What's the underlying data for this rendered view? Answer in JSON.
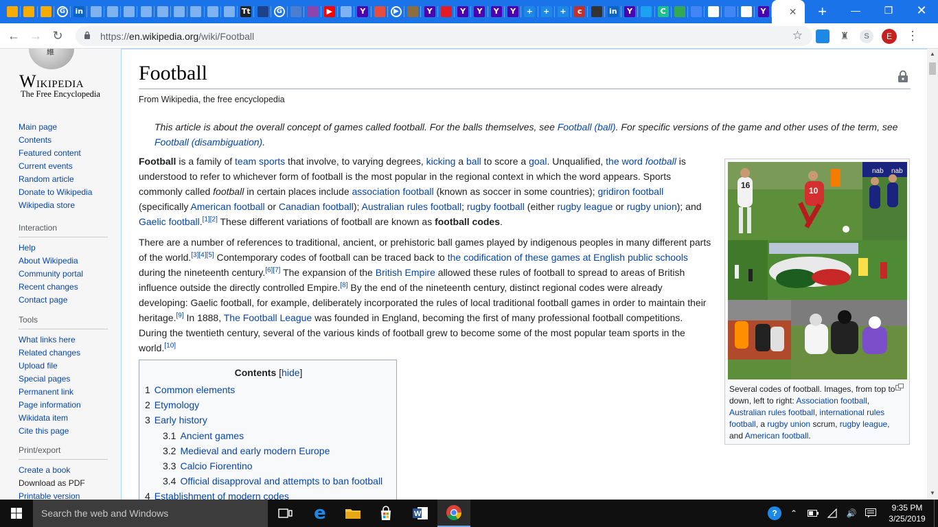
{
  "browser": {
    "tabs": [
      {
        "icon": "analytics-icon",
        "glyph": "",
        "color": "#f9ab00"
      },
      {
        "icon": "analytics-icon",
        "glyph": "",
        "color": "#f9ab00"
      },
      {
        "icon": "analytics-icon",
        "glyph": "",
        "color": "#f9ab00"
      },
      {
        "icon": "google-icon",
        "glyph": "G",
        "color": "#ffffff"
      },
      {
        "icon": "linkedin-icon",
        "glyph": "in",
        "color": "#0a66c2"
      },
      {
        "icon": "doc-icon",
        "glyph": "",
        "color": "#7fb2f0"
      },
      {
        "icon": "doc-icon",
        "glyph": "",
        "color": "#7fb2f0"
      },
      {
        "icon": "doc-icon",
        "glyph": "",
        "color": "#7fb2f0"
      },
      {
        "icon": "doc-icon",
        "glyph": "",
        "color": "#7fb2f0"
      },
      {
        "icon": "doc-icon",
        "glyph": "",
        "color": "#7fb2f0"
      },
      {
        "icon": "doc-icon",
        "glyph": "",
        "color": "#7fb2f0"
      },
      {
        "icon": "doc-icon",
        "glyph": "",
        "color": "#7fb2f0"
      },
      {
        "icon": "doc-icon",
        "glyph": "",
        "color": "#7fb2f0"
      },
      {
        "icon": "doc-icon",
        "glyph": "",
        "color": "#7fb2f0"
      },
      {
        "icon": "news-icon",
        "glyph": "Tt",
        "color": "#222222"
      },
      {
        "icon": "sports-icon",
        "glyph": "",
        "color": "#1d428a"
      },
      {
        "icon": "google-icon",
        "glyph": "G",
        "color": "#ffffff"
      },
      {
        "icon": "blank-icon",
        "glyph": "",
        "color": "#4a7fd0"
      },
      {
        "icon": "podcast-icon",
        "glyph": "",
        "color": "#8e44ad"
      },
      {
        "icon": "youtube-icon",
        "glyph": "▶",
        "color": "#ff0000"
      },
      {
        "icon": "chart-icon",
        "glyph": "",
        "color": "#7fb2f0"
      },
      {
        "icon": "yahoo-icon",
        "glyph": "Y",
        "color": "#4d00ae"
      },
      {
        "icon": "fox-icon",
        "glyph": "",
        "color": "#e84c3d"
      },
      {
        "icon": "video-icon",
        "glyph": "▶",
        "color": "#ffffff"
      },
      {
        "icon": "shield-icon",
        "glyph": "",
        "color": "#8c6d3f"
      },
      {
        "icon": "yahoo-icon",
        "glyph": "Y",
        "color": "#4d00ae"
      },
      {
        "icon": "brand-icon",
        "glyph": "",
        "color": "#e31b23"
      },
      {
        "icon": "yahoo-icon",
        "glyph": "Y",
        "color": "#4d00ae"
      },
      {
        "icon": "yahoo-icon",
        "glyph": "Y",
        "color": "#4d00ae"
      },
      {
        "icon": "yahoo-icon",
        "glyph": "Y",
        "color": "#4d00ae"
      },
      {
        "icon": "yahoo-icon",
        "glyph": "Y",
        "color": "#4d00ae"
      },
      {
        "icon": "plus-icon",
        "glyph": "+",
        "color": "#1e88e5"
      },
      {
        "icon": "plus-icon",
        "glyph": "+",
        "color": "#1e88e5"
      },
      {
        "icon": "plus-icon",
        "glyph": "+",
        "color": "#1e88e5"
      },
      {
        "icon": "cnet-icon",
        "glyph": "c",
        "color": "#c4302b"
      },
      {
        "icon": "shield-icon",
        "glyph": "",
        "color": "#333333"
      },
      {
        "icon": "linkedin-icon",
        "glyph": "in",
        "color": "#0a66c2"
      },
      {
        "icon": "yahoo-icon",
        "glyph": "Y",
        "color": "#4d00ae"
      },
      {
        "icon": "twitter-icon",
        "glyph": "",
        "color": "#1da1f2"
      },
      {
        "icon": "c-icon",
        "glyph": "C",
        "color": "#1fbf8f"
      },
      {
        "icon": "analytics-icon",
        "glyph": "",
        "color": "#34a853"
      },
      {
        "icon": "docs-icon",
        "glyph": "",
        "color": "#4285f4"
      },
      {
        "icon": "gmail-icon",
        "glyph": "",
        "color": "#ffffff"
      },
      {
        "icon": "docs-icon",
        "glyph": "",
        "color": "#4285f4"
      },
      {
        "icon": "gmail-icon",
        "glyph": "",
        "color": "#ffffff"
      },
      {
        "icon": "yahoo-icon",
        "glyph": "Y",
        "color": "#4d00ae"
      }
    ],
    "url": {
      "scheme": "https://",
      "host": "en.wikipedia.org",
      "path": "/wiki/Football"
    },
    "profile_initial": "E",
    "accent": "#1a73e8"
  },
  "sidebar": {
    "wordmark": "Wikipedia",
    "tagline": "The Free Encyclopedia",
    "navigation": [
      "Main page",
      "Contents",
      "Featured content",
      "Current events",
      "Random article",
      "Donate to Wikipedia",
      "Wikipedia store"
    ],
    "interaction": {
      "heading": "Interaction",
      "items": [
        "Help",
        "About Wikipedia",
        "Community portal",
        "Recent changes",
        "Contact page"
      ]
    },
    "tools": {
      "heading": "Tools",
      "items": [
        "What links here",
        "Related changes",
        "Upload file",
        "Special pages",
        "Permanent link",
        "Page information",
        "Wikidata item",
        "Cite this page"
      ]
    },
    "print": {
      "heading": "Print/export",
      "items": [
        "Create a book",
        "Download as PDF",
        "Printable version"
      ]
    }
  },
  "article": {
    "title": "Football",
    "site_sub": "From Wikipedia, the free encyclopedia",
    "hatnote": {
      "t1": "This article is about the overall concept of games called football. For the balls themselves, see ",
      "l1": "Football (ball)",
      "t2": ". For specific versions of the game and other uses of the term, see ",
      "l2": "Football (disambiguation)",
      "t3": "."
    },
    "p1": {
      "b1": "Football",
      "t1": " is a family of ",
      "l1": "team sports",
      "t2": " that involve, to varying degrees, ",
      "l2": "kicking",
      "t3": " a ",
      "l3": "ball",
      "t4": " to score a ",
      "l4": "goal",
      "t5": ". Unqualified, ",
      "l5a": "the word ",
      "l5b": "football",
      "t6": " is understood to refer to whichever form of football is the most popular in the regional context in which the word appears. Sports commonly called ",
      "i1": "football",
      "t7": " in certain places include ",
      "l6": "association football",
      "t8": " (known as soccer in some countries); ",
      "l7": "gridiron football",
      "t9": " (specifically ",
      "l8": "American football",
      "t10": " or ",
      "l9": "Canadian football",
      "t11": "); ",
      "l10": "Australian rules football",
      "t12": "; ",
      "l11": "rugby football",
      "t13": " (either ",
      "l12": "rugby league",
      "t14": " or ",
      "l13": "rugby union",
      "t15": "); and ",
      "l14": "Gaelic football",
      "t16": ".",
      "r1": "[1][2]",
      "t17": " These different variations of football are known as ",
      "b2": "football codes",
      "t18": "."
    },
    "p2": {
      "t1": "There are a number of references to traditional, ancient, or prehistoric ball games played by indigenous peoples in many different parts of the world.",
      "r1": "[3][4][5]",
      "t2": " Contemporary codes of football can be traced back to ",
      "l1": "the codification of these games at English public schools",
      "t3": " during the nineteenth century.",
      "r2": "[6][7]",
      "t4": " The expansion of the ",
      "l2": "British Empire",
      "t5": " allowed these rules of football to spread to areas of British influence outside the directly controlled Empire.",
      "r3": "[8]",
      "t6": " By the end of the nineteenth century, distinct regional codes were already developing: Gaelic football, for example, deliberately incorporated the rules of local traditional football games in order to maintain their heritage.",
      "r4": "[9]",
      "t7": " In 1888, ",
      "l3": "The Football League",
      "t8": " was founded in England, becoming the first of many professional football competitions. During the twentieth century, several of the various kinds of football grew to become some of the most popular team sports in the world.",
      "r5": "[10]"
    },
    "toc": {
      "title": "Contents",
      "toggle": "hide",
      "entries": [
        {
          "num": "1",
          "label": "Common elements"
        },
        {
          "num": "2",
          "label": "Etymology"
        },
        {
          "num": "3",
          "label": "Early history"
        },
        {
          "num": "3.1",
          "label": "Ancient games"
        },
        {
          "num": "3.2",
          "label": "Medieval and early modern Europe"
        },
        {
          "num": "3.3",
          "label": "Calcio Fiorentino"
        },
        {
          "num": "3.4",
          "label": "Official disapproval and attempts to ban football"
        },
        {
          "num": "4",
          "label": "Establishment of modern codes"
        }
      ]
    },
    "thumb": {
      "caption_text": "Several codes of football. Images, from top to down, left to right: ",
      "c1": "Association football",
      "c2": "Australian rules football",
      "c3": "international rules football",
      "c4": "rugby union",
      "c5": "rugby league",
      "c6": "American football",
      "sep1": ", ",
      "sep2": ", ",
      "sep3": ", a ",
      "sep4": " scrum, ",
      "sep5": ", and ",
      "sep6": ".",
      "photo_texts": {
        "jersey_a": "16",
        "jersey_b": "10",
        "sponsor": "nab"
      }
    }
  },
  "taskbar": {
    "search_placeholder": "Search the web and Windows",
    "time": "9:35 PM",
    "date": "3/25/2019"
  }
}
